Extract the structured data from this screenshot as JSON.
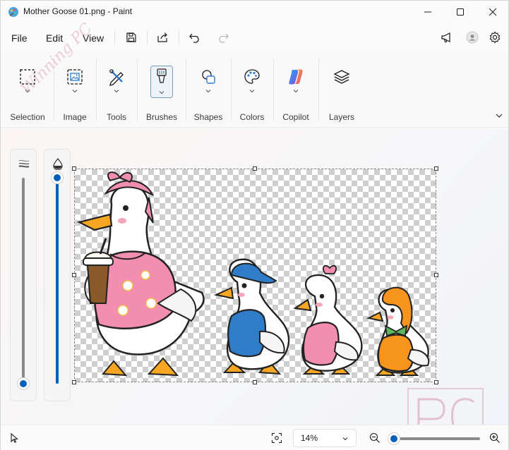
{
  "window": {
    "title": "Mother Goose 01.png - Paint"
  },
  "menu": {
    "file": "File",
    "edit": "Edit",
    "view": "View"
  },
  "ribbon": {
    "groups": [
      {
        "label": "Selection",
        "icon": "selection-icon"
      },
      {
        "label": "Image",
        "icon": "image-icon"
      },
      {
        "label": "Tools",
        "icon": "tools-icon"
      },
      {
        "label": "Brushes",
        "icon": "brush-icon"
      },
      {
        "label": "Shapes",
        "icon": "shapes-icon"
      },
      {
        "label": "Colors",
        "icon": "palette-icon"
      },
      {
        "label": "Copilot",
        "icon": "copilot-icon"
      },
      {
        "label": "Layers",
        "icon": "layers-icon"
      }
    ]
  },
  "sliders": {
    "size_level": 0.0,
    "opacity_level": 1.0
  },
  "statusbar": {
    "zoom": "14%",
    "zoom_level": 0.02
  },
  "watermark": {
    "text": "Winning PC",
    "logo": "PC"
  },
  "colors": {
    "accent": "#005fb8",
    "pink_shirt": "#f28fb0",
    "blue_shirt": "#2f7cc8",
    "orange_hood": "#f7941d"
  }
}
